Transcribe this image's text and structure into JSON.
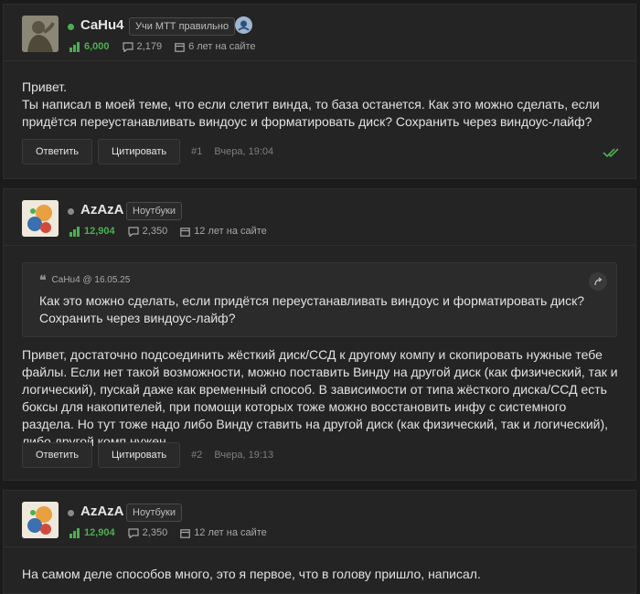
{
  "posts": [
    {
      "username": "CaHu4",
      "badge": "Учи МТТ правильно",
      "online_color": "#4caf50",
      "reputation": "6,000",
      "messages": "2,179",
      "tenure": "6 лет на сайте",
      "body": "Привет.\nТы написал в моей теме, что если слетит винда, то база останется. Как это можно сделать, если придётся переустанавливать виндоус и форматировать диск? Сохранить через виндоус-лайф?",
      "reply_label": "Ответить",
      "quote_label": "Цитировать",
      "number": "#1",
      "date": "Вчера, 19:04"
    },
    {
      "username": "AzAzA",
      "badge": "Ноутбуки",
      "online_color": "#8a8a8a",
      "reputation": "12,904",
      "messages": "2,350",
      "tenure": "12 лет на сайте",
      "quote_author": "CaHu4 @ 16.05.25",
      "quote_body": "Как это можно сделать, если придётся переустанавливать виндоус и форматировать диск? Сохранить через виндоус-лайф?",
      "body": "Привет, достаточно подсоединить жёсткий диск/ССД к другому компу и скопировать нужные тебе файлы. Если нет такой возможности, можно поставить Винду на другой диск (как физический, так и логический), пускай даже как временный способ. В зависимости от типа жёсткого диска/ССД есть боксы для накопителей, при помощи которых тоже можно восстановить инфу с системного раздела. Но тут тоже надо либо Винду ставить на другой диск (как физический, так и логический), либо другой комп нужен.",
      "reply_label": "Ответить",
      "quote_label": "Цитировать",
      "number": "#2",
      "date": "Вчера, 19:13"
    },
    {
      "username": "AzAzA",
      "badge": "Ноутбуки",
      "online_color": "#8a8a8a",
      "reputation": "12,904",
      "messages": "2,350",
      "tenure": "12 лет на сайте",
      "body": "На самом деле способов много, это я первое, что в голову пришло, написал."
    }
  ],
  "accent_green": "#4caf50",
  "icons": [
    "reputation-icon",
    "messages-icon",
    "calendar-icon",
    "checkmark-icon",
    "quote-icon",
    "jump-arrow-icon",
    "club-icon"
  ]
}
